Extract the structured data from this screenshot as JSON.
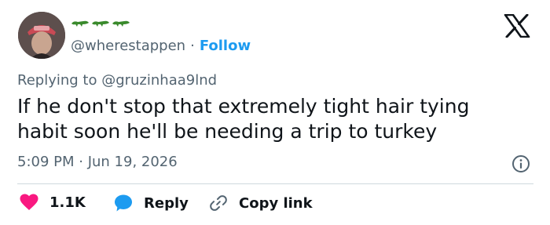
{
  "tweet": {
    "handle": "@wherestappen",
    "separator": "·",
    "follow_label": "Follow",
    "replying_to": "Replying to @gruzinhaa9lnd",
    "text_line1": "If he don't stop that extremely tight hair tying",
    "text_line2": "habit soon he'll be needing a trip to turkey",
    "timestamp": "5:09 PM · Jun 19, 2026"
  },
  "actions": {
    "like_count": "1.1K",
    "reply_label": "Reply",
    "copy_link_label": "Copy link"
  },
  "icons": {
    "display_name": "crocodile-emoji",
    "logo": "x-logo",
    "info": "info-icon",
    "like": "heart-icon",
    "reply": "speech-bubble-icon",
    "copy": "link-icon"
  },
  "colors": {
    "accent": "#1d9bf0",
    "heart": "#f91880",
    "secondary_text": "#536471",
    "primary_text": "#0f1419",
    "crocodile": "#3a8a2c"
  }
}
